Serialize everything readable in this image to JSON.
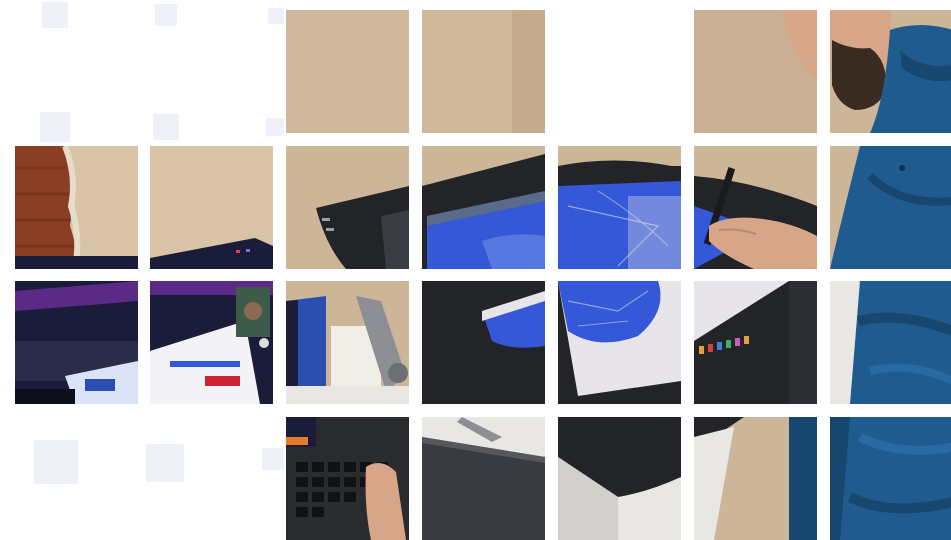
{
  "photo": {
    "subject": "person-drawing-on-pen-display-tablet-next-to-laptop",
    "colors": {
      "wall": "#cdb597",
      "wall_light": "#d9c4a7",
      "brick": "#8a3e24",
      "shirt": "#1f5b8e",
      "shirt_dark": "#17466f",
      "skin": "#d7a688",
      "beard": "#3a2b22",
      "tablet_bezel": "#222428",
      "screen_canvas": "#e7e4ea",
      "screen_blue": "#3458d8",
      "laptop_screen": "#1b1c3a",
      "laptop_body": "#2a2b2f",
      "desk": "#e9e7e3",
      "stand_metal": "#8d8f94"
    }
  },
  "ghost_squares": {
    "color": "#eef2f8"
  }
}
